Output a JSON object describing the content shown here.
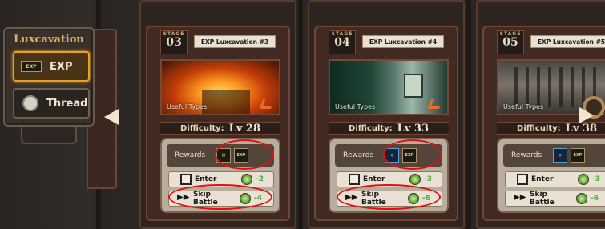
{
  "menu": {
    "title": "Luxcavation",
    "items": [
      {
        "label": "EXP",
        "badge": "EXP",
        "active": true
      },
      {
        "label": "Thread",
        "active": false
      }
    ]
  },
  "cards": [
    {
      "stage_label": "STAGE",
      "stage_num": "03",
      "title": "EXP Luxcavation #3",
      "art_caption": "Useful Types",
      "difficulty_label": "Difficulty:",
      "level": "Lv 28",
      "rewards_label": "Rewards",
      "enter_label": "Enter",
      "enter_cost": "-2",
      "skip_label": "Skip Battle",
      "skip_cost": "-4"
    },
    {
      "stage_label": "STAGE",
      "stage_num": "04",
      "title": "EXP Luxcavation #4",
      "art_caption": "Useful Types",
      "difficulty_label": "Difficulty:",
      "level": "Lv 33",
      "rewards_label": "Rewards",
      "enter_label": "Enter",
      "enter_cost": "-3",
      "skip_label": "Skip Battle",
      "skip_cost": "-6"
    },
    {
      "stage_label": "STAGE",
      "stage_num": "05",
      "title": "EXP Luxcavation #5",
      "art_caption": "Useful Types",
      "difficulty_label": "Difficulty:",
      "level": "Lv 38",
      "rewards_label": "Rewards",
      "enter_label": "Enter",
      "enter_cost": "-3",
      "skip_label": "Skip Battle",
      "skip_cost": "-6"
    }
  ],
  "icons": {
    "arrow_left": "arrow-left-icon",
    "arrow_right": "arrow-right-icon",
    "fast_forward": "fast-forward-icon",
    "ticket": "ticket-icon",
    "stamina": "stamina-icon"
  },
  "colors": {
    "accent": "#e8a025",
    "cost_green": "#49a43a",
    "annotation_red": "#e01010"
  }
}
